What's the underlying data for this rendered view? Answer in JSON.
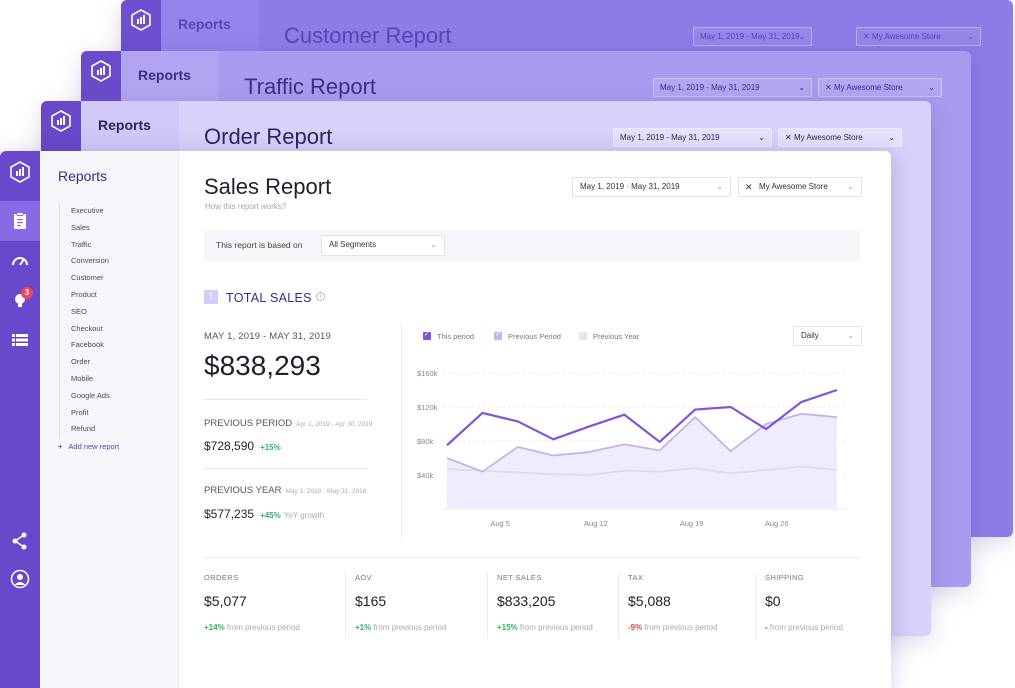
{
  "cards": [
    {
      "id": "card3",
      "side_title": "Reports",
      "title": "Customer Report",
      "date_range": "May 1, 2019 - May 31, 2019",
      "store": "My Awesome Store"
    },
    {
      "id": "card2",
      "side_title": "Reports",
      "title": "Traffic Report",
      "date_range": "May 1, 2019 - May 31, 2019",
      "store": "My Awesome Store"
    },
    {
      "id": "card1",
      "side_title": "Reports",
      "title": "Order Report",
      "date_range": "May 1, 2019 - May 31, 2019",
      "store": "My Awesome Store"
    }
  ],
  "rail": {
    "notification_count": "3"
  },
  "sidebar": {
    "title": "Reports",
    "items": [
      "Executive",
      "Sales",
      "Traffic",
      "Conversion",
      "Customer",
      "Product",
      "SEO",
      "Checkout",
      "Facebook",
      "Order",
      "Mobile",
      "Google Ads",
      "Profit",
      "Refund"
    ],
    "add_label": "Add new report"
  },
  "header": {
    "title": "Sales Report",
    "subtitle": "How this report works?",
    "date_prefix": "May 1, 2019",
    "date_suffix": "May 31, 2019",
    "store": "My Awesome Store"
  },
  "segment": {
    "label": "This report is based on",
    "value": "All Segments"
  },
  "total_sales": {
    "number": "1",
    "title": "TOTAL SALES",
    "range": "MAY 1, 2019 - MAY 31, 2019",
    "value": "$838,293",
    "previous_period": {
      "label": "PREVIOUS PERIOD",
      "range": "Apr 1, 2019 - Apr 30, 2019",
      "value": "$728,590",
      "change": "+15%"
    },
    "previous_year": {
      "label": "PREVIOUS YEAR",
      "range": "May 1, 2018 - May 31, 2018",
      "value": "$577,235",
      "change": "+45%",
      "note": "YoY growth"
    }
  },
  "chart_controls": {
    "granularity": "Daily"
  },
  "colors": {
    "this_period": "#7f56d9",
    "previous_period": "#c5b3ee",
    "previous_year": "#dddde8",
    "positive": "#2fb468",
    "negative": "#e04a4a",
    "accent": "#6a48cc"
  },
  "chart_data": {
    "type": "line",
    "x": [
      "Aug 1",
      "Aug 4",
      "Aug 8",
      "Aug 11",
      "Aug 15",
      "Aug 19",
      "Aug 22",
      "Aug 26",
      "Aug 29",
      "Sep 1"
    ],
    "x_ticks": [
      "Aug 5",
      "Aug 12",
      "Aug 19",
      "Aug 26"
    ],
    "y_ticks": [
      "$40k",
      "$80k",
      "$120k",
      "$160k"
    ],
    "ylim": [
      0,
      160
    ],
    "y_unit": "$k",
    "grid": true,
    "legend_position": "top-left",
    "series": [
      {
        "name": "This period",
        "values": [
          75,
          113,
          103,
          82,
          97,
          111,
          79,
          117,
          120,
          94,
          126,
          140
        ]
      },
      {
        "name": "Previous Period",
        "values": [
          60,
          44,
          73,
          63,
          67,
          76,
          69,
          108,
          68,
          100,
          112,
          108
        ]
      },
      {
        "name": "Previous Year",
        "values": [
          47,
          45,
          43,
          41,
          40,
          45,
          44,
          48,
          42,
          46,
          50,
          46
        ]
      }
    ]
  },
  "metrics": [
    {
      "label": "ORDERS",
      "value": "$5,077",
      "change": "+14%",
      "note": "from previous period"
    },
    {
      "label": "AOV",
      "value": "$165",
      "change": "+1%",
      "note": "from previous period"
    },
    {
      "label": "NET SALES",
      "value": "$833,205",
      "change": "+15%",
      "note": "from previous period"
    },
    {
      "label": "TAX",
      "value": "$5,088",
      "change": "-9%",
      "note": "from previous period"
    },
    {
      "label": "SHIPPING",
      "value": "$0",
      "change": "-",
      "note": "from previous period"
    }
  ]
}
